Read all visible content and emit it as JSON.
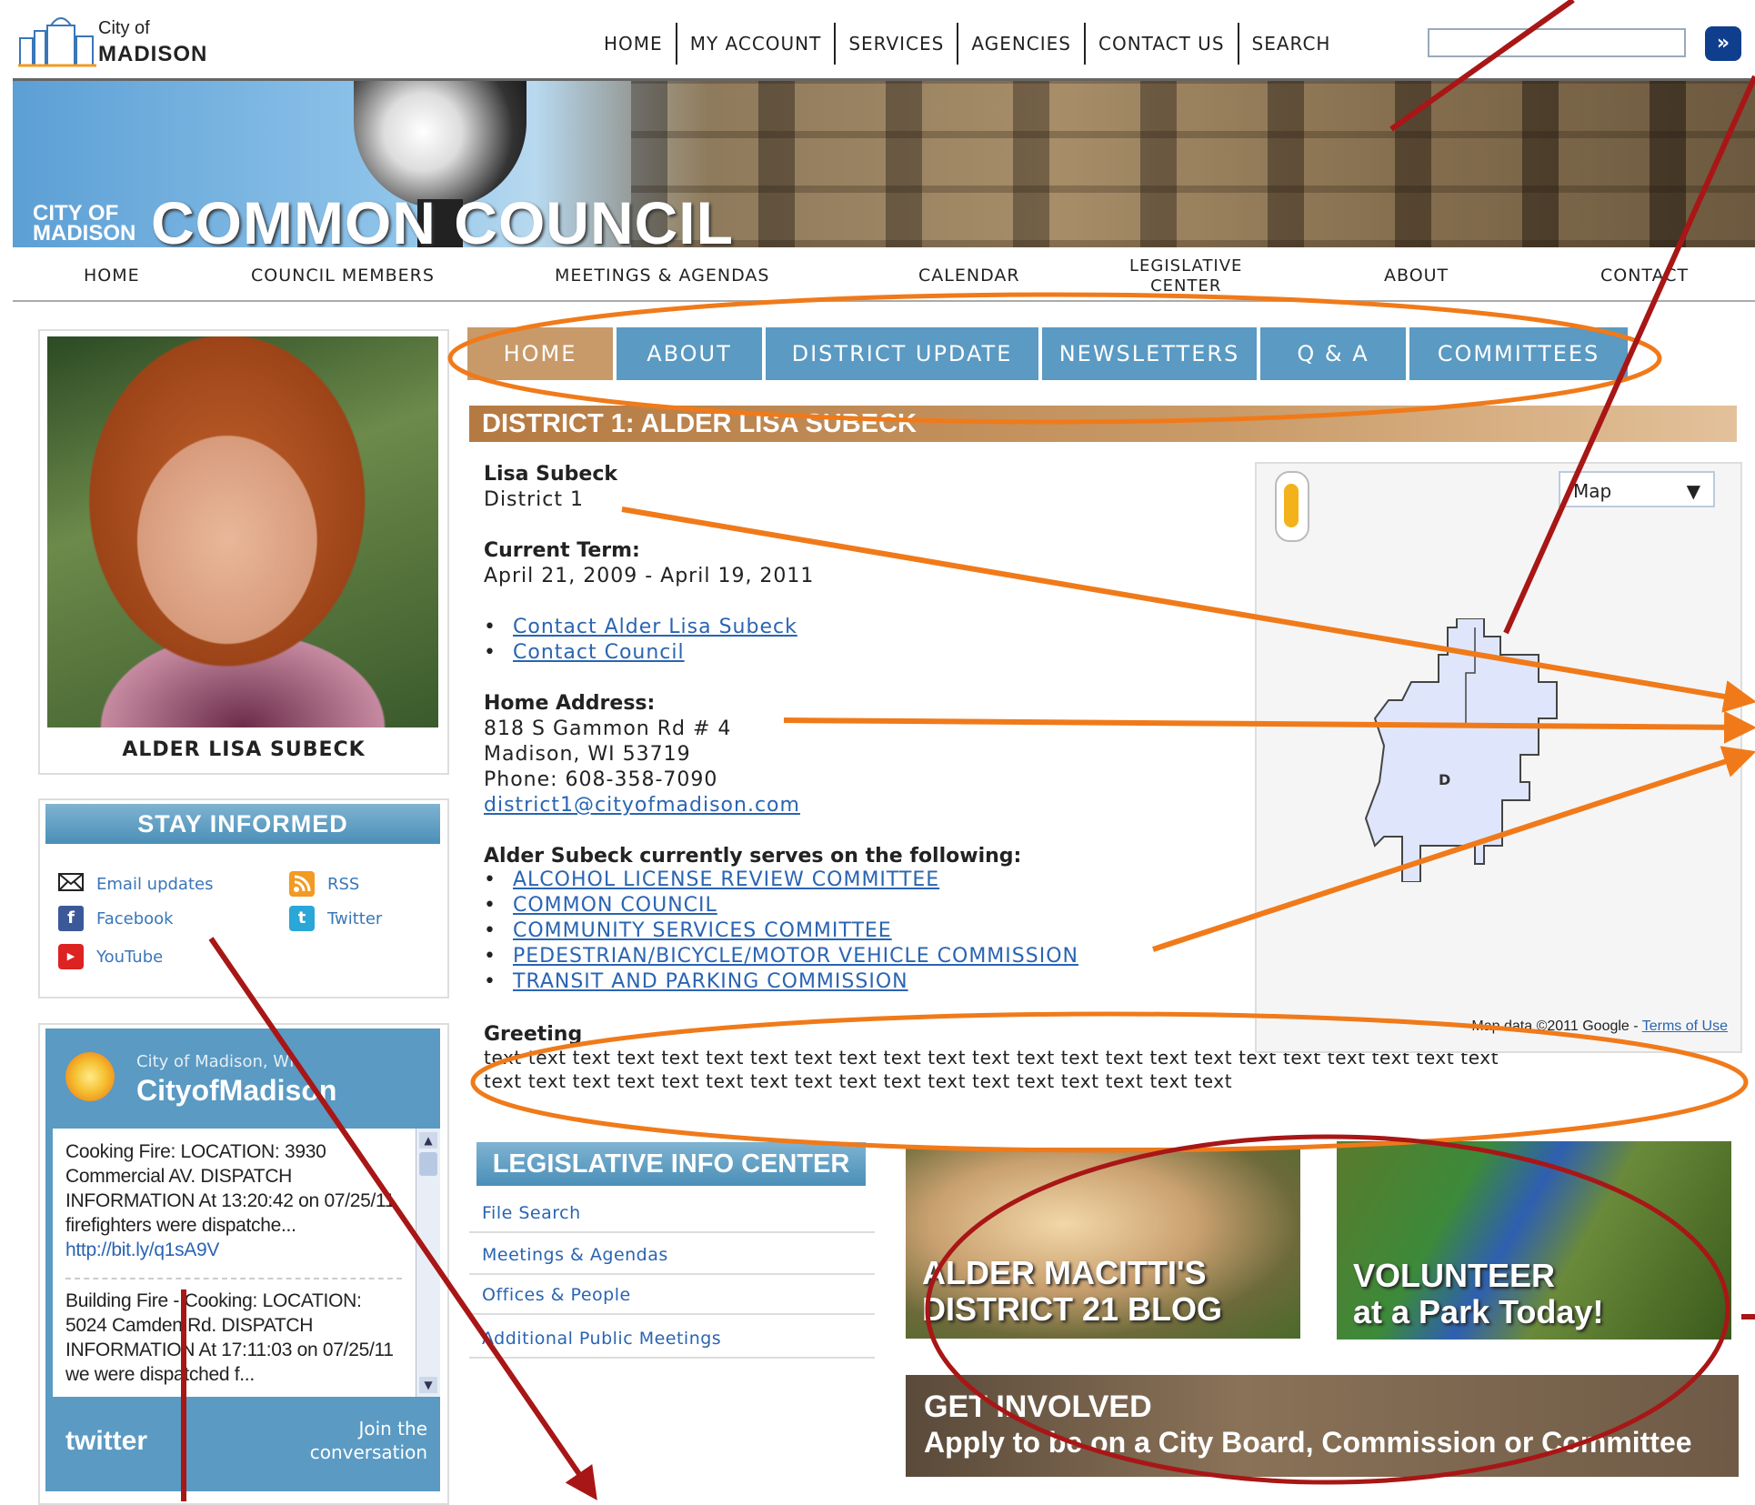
{
  "logo": {
    "line1": "City of",
    "line2": "MADISON"
  },
  "top_nav": {
    "items": [
      "HOME",
      "MY ACCOUNT",
      "SERVICES",
      "AGENCIES",
      "CONTACT US"
    ],
    "search_label": "SEARCH",
    "search_value": "",
    "search_button": "»"
  },
  "banner": {
    "city_of_line1": "CITY OF",
    "city_of_line2": "MADISON",
    "title": "COMMON COUNCIL"
  },
  "council_nav": {
    "home": "HOME",
    "members": "COUNCIL MEMBERS",
    "meetings": "MEETINGS & AGENDAS",
    "calendar": "CALENDAR",
    "legislative_1": "LEGISLATIVE",
    "legislative_2": "CENTER",
    "about": "ABOUT",
    "contact": "CONTACT"
  },
  "profile": {
    "caption": "ALDER LISA SUBECK"
  },
  "stay_informed": {
    "title": "STAY INFORMED",
    "email": "Email updates",
    "rss": "RSS",
    "facebook": "Facebook",
    "twitter": "Twitter",
    "youtube": "YouTube"
  },
  "twitter_widget": {
    "subtitle": "City of Madison, WI",
    "name": "CityofMadison",
    "tweets": [
      {
        "text": "Cooking Fire: LOCATION: 3930 Commercial AV. DISPATCH INFORMATION At 13:20:42 on 07/25/11 firefighters were dispatche...",
        "link": "http://bit.ly/q1sA9V"
      },
      {
        "text": "Building Fire - Cooking: LOCATION: 5024 Camden Rd. DISPATCH INFORMATION At 17:11:03 on 07/25/11 we were dispatched f...",
        "link": ""
      }
    ],
    "logo": "twitter",
    "join_1": "Join the",
    "join_2": "conversation"
  },
  "tabs": [
    "HOME",
    "ABOUT",
    "DISTRICT UPDATE",
    "NEWSLETTERS",
    "Q & A",
    "COMMITTEES"
  ],
  "district": {
    "header": "DISTRICT 1: ALDER LISA SUBECK",
    "name": "Lisa Subeck",
    "district": "District 1",
    "term_label": "Current Term:",
    "term": "April 21, 2009 - April 19, 2011",
    "contact_links": [
      "Contact Alder Lisa Subeck",
      "Contact Council"
    ],
    "address_label": "Home Address:",
    "address_1": "818 S Gammon Rd # 4",
    "address_2": "Madison, WI 53719",
    "phone": "Phone: 608-358-7090",
    "email": "district1@cityofmadison.com",
    "serves_label": "Alder Subeck currently serves on the following:",
    "committees": [
      "ALCOHOL LICENSE REVIEW COMMITTEE",
      "COMMON COUNCIL",
      "COMMUNITY SERVICES COMMITTEE",
      "PEDESTRIAN/BICYCLE/MOTOR VEHICLE COMMISSION",
      "TRANSIT AND PARKING COMMISSION"
    ],
    "greeting_label": "Greeting",
    "greeting_1": "text text text text text text text text text text text text text text text text text text text text text text text",
    "greeting_2": "text text text text text text text text text text text text text text text text text"
  },
  "map": {
    "type_select": "Map",
    "credit": "Map data ©2011 Google -",
    "terms": "Terms of Use",
    "marker": "D"
  },
  "legislative": {
    "title": "LEGISLATIVE INFO CENTER",
    "items": [
      "File Search",
      "Meetings & Agendas",
      "Offices & People",
      "Additional Public Meetings"
    ]
  },
  "promos": {
    "blog_1": "ALDER MACITTI'S",
    "blog_2": "DISTRICT 21 BLOG",
    "volunteer_1": "VOLUNTEER",
    "volunteer_2": "at a Park Today!",
    "involved_1": "GET INVOLVED",
    "involved_2": "Apply to be on a City Board, Commission or Committee"
  },
  "colors": {
    "tab_blue": "#5a9ac3",
    "tab_active": "#c89a6a",
    "annotation_orange": "#f07a1a",
    "annotation_red": "#a81616"
  }
}
